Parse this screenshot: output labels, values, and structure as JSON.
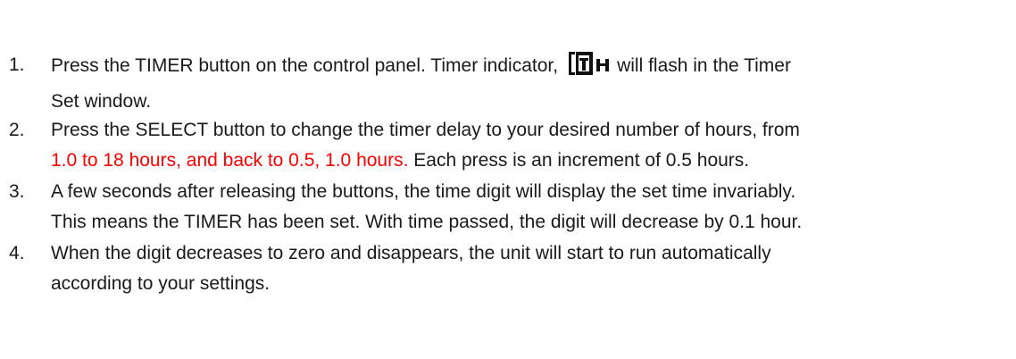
{
  "instructions": [
    {
      "number": "1.",
      "line1_before_icon": "Press the TIMER button on the control panel. Timer indicator,",
      "icon_name": "timer-indicator-icon",
      "line1_after_icon": "will flash in the Timer",
      "line2": "Set window."
    },
    {
      "number": "2.",
      "line1": "Press the SELECT button to change the timer delay to your desired number of hours, from",
      "line2_red": "1.0 to 18 hours, and back to 0.5, 1.0 hours.",
      "line2_rest": " Each press is an increment of 0.5 hours.",
      "highlight_color": "#ff0000"
    },
    {
      "number": "3.",
      "line1": "A few seconds after releasing the buttons, the time digit will display the set time invariably.",
      "line2": "This means the TIMER has been set. With time passed, the digit will decrease by 0.1 hour."
    },
    {
      "number": "4.",
      "line1": "When the digit decreases to zero and disappears, the unit will start to run automatically",
      "line2": "according to your settings."
    }
  ]
}
